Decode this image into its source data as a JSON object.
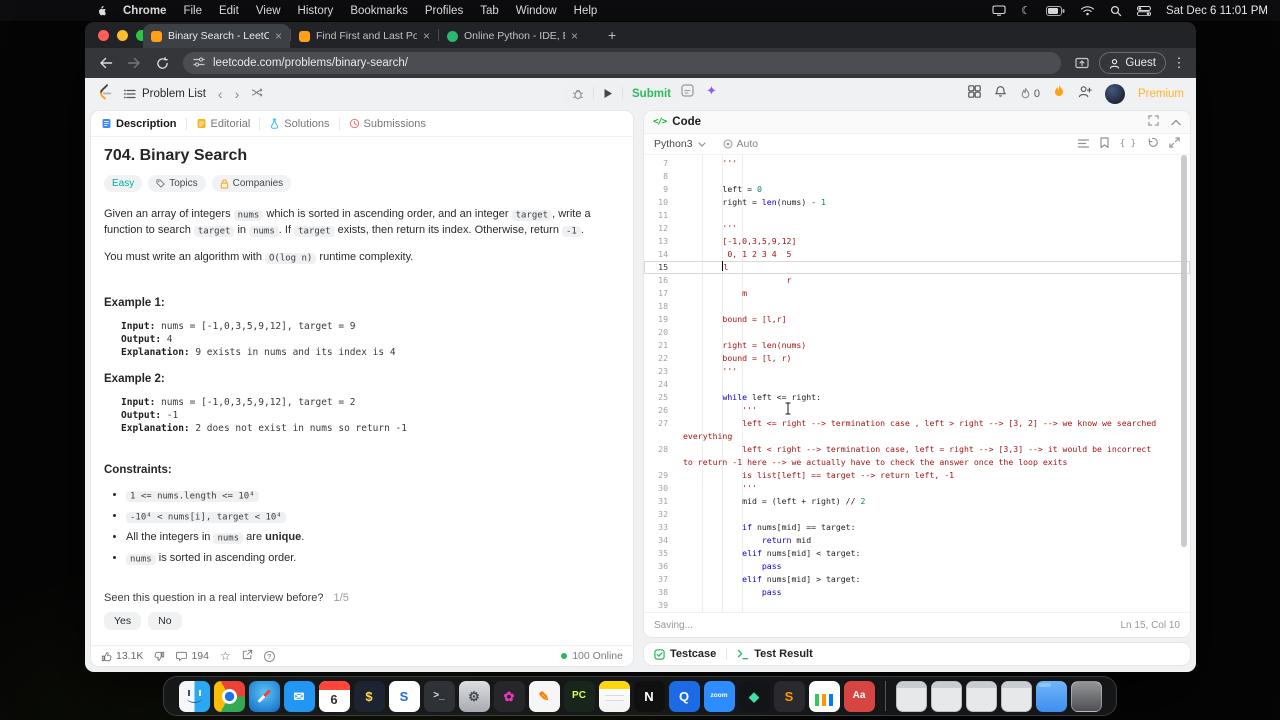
{
  "colors": {
    "submit_green": "#2cbb5d",
    "premium_orange": "#ffa116",
    "easy_teal": "#00af9b",
    "string_red": "#a31515",
    "keyword_blue": "#0b00c7",
    "number_green": "#098658"
  },
  "icons": {
    "close": "×",
    "new_tab": "+",
    "menu_dots": "⋮",
    "code_tag": "</>",
    "braces": "{ }",
    "sparkle": "✦",
    "moon": "☾",
    "star": "☆",
    "help": "?",
    "prev": "‹",
    "next": "›"
  },
  "menubar": {
    "menus": [
      "Chrome",
      "File",
      "Edit",
      "View",
      "History",
      "Bookmarks",
      "Profiles",
      "Tab",
      "Window",
      "Help"
    ],
    "clock": "Sat Dec 6 11:01 PM"
  },
  "browser": {
    "tabs": [
      {
        "title": "Binary Search - LeetCode",
        "favicon": "leetcode",
        "active": true
      },
      {
        "title": "Find First and Last Position o",
        "favicon": "leetcode",
        "active": false
      },
      {
        "title": "Online Python - IDE, Editor, C",
        "favicon": "python-ide",
        "active": false
      }
    ],
    "url": "leetcode.com/problems/binary-search/",
    "guest": "Guest"
  },
  "header": {
    "problem_list": "Problem List",
    "submit": "Submit",
    "streak": "0",
    "premium": "Premium"
  },
  "tabs_bar": {
    "description": "Description",
    "editorial": "Editorial",
    "solutions": "Solutions",
    "submissions": "Submissions"
  },
  "problem": {
    "title": "704. Binary Search",
    "difficulty": "Easy",
    "topics": "Topics",
    "companies": "Companies",
    "p1": [
      {
        "t": "Given an array of integers "
      },
      {
        "c": "nums"
      },
      {
        "t": " which is sorted in ascending order, and an integer "
      },
      {
        "c": "target"
      },
      {
        "t": ", write a function to search "
      },
      {
        "c": "target"
      },
      {
        "t": " in "
      },
      {
        "c": "nums"
      },
      {
        "t": ". If "
      },
      {
        "c": "target"
      },
      {
        "t": " exists, then return its index. Otherwise, return "
      },
      {
        "c": "-1"
      },
      {
        "t": "."
      }
    ],
    "p2": [
      {
        "t": "You must write an algorithm with "
      },
      {
        "c": "O(log n)"
      },
      {
        "t": " runtime complexity."
      }
    ],
    "example1_label": "Example 1:",
    "example1": [
      [
        "Input:",
        " nums = [-1,0,3,5,9,12], target = 9"
      ],
      [
        "Output:",
        " 4"
      ],
      [
        "Explanation:",
        " 9 exists in nums and its index is 4"
      ]
    ],
    "example2_label": "Example 2:",
    "example2": [
      [
        "Input:",
        " nums = [-1,0,3,5,9,12], target = 2"
      ],
      [
        "Output:",
        " -1"
      ],
      [
        "Explanation:",
        " 2 does not exist in nums so return -1"
      ]
    ],
    "constraints_label": "Constraints:",
    "constraints": [
      [
        {
          "c": "1 <= nums.length <= 10⁴"
        }
      ],
      [
        {
          "c": "-10⁴ < nums[i], target < 10⁴"
        }
      ],
      [
        {
          "t": "All the integers in "
        },
        {
          "c": "nums"
        },
        {
          "t": " are "
        },
        {
          "b": "unique"
        },
        {
          "t": "."
        }
      ],
      [
        {
          "c": "nums"
        },
        {
          "t": " is sorted in ascending order."
        }
      ]
    ],
    "survey_q": "Seen this question in a real interview before?",
    "survey_progress": "1/5",
    "yes": "Yes",
    "no": "No",
    "likes": "13.1K",
    "comments": "194",
    "online": "100 Online"
  },
  "code_panel": {
    "title": "Code",
    "lang": "Python3",
    "auto": "Auto",
    "saving": "Saving...",
    "cursor_pos": "Ln 15, Col 10",
    "testcase": "Testcase",
    "test_result": "Test Result"
  },
  "editor": {
    "rows": [
      {
        "n": "7",
        "s": [
          {
            "c": "str",
            "t": "        '''"
          }
        ]
      },
      {
        "n": "8",
        "s": []
      },
      {
        "n": "9",
        "s": [
          {
            "c": "pl",
            "t": "        left = "
          },
          {
            "c": "num",
            "t": "0"
          }
        ]
      },
      {
        "n": "10",
        "s": [
          {
            "c": "pl",
            "t": "        right = "
          },
          {
            "c": "kw",
            "t": "len"
          },
          {
            "c": "pl",
            "t": "(nums) - "
          },
          {
            "c": "num",
            "t": "1"
          }
        ]
      },
      {
        "n": "11",
        "s": []
      },
      {
        "n": "12",
        "s": [
          {
            "c": "str",
            "t": "        '''"
          }
        ]
      },
      {
        "n": "13",
        "s": [
          {
            "c": "str",
            "t": "        [-1,0,3,5,9,12]"
          }
        ]
      },
      {
        "n": "14",
        "s": [
          {
            "c": "str",
            "t": "         0, 1 2 3 4  5"
          }
        ]
      },
      {
        "n": "15",
        "cur": true,
        "s": [
          {
            "c": "str",
            "t": "        "
          },
          {
            "k": "caret"
          },
          {
            "c": "str",
            "t": "l"
          }
        ]
      },
      {
        "n": "16",
        "s": [
          {
            "c": "str",
            "t": "                     r"
          }
        ]
      },
      {
        "n": "17",
        "s": [
          {
            "c": "str",
            "t": "            m"
          }
        ]
      },
      {
        "n": "18",
        "s": []
      },
      {
        "n": "19",
        "s": [
          {
            "c": "str",
            "t": "        bound = [l,r]"
          }
        ]
      },
      {
        "n": "20",
        "s": []
      },
      {
        "n": "21",
        "s": [
          {
            "c": "str",
            "t": "        right = len(nums)"
          }
        ]
      },
      {
        "n": "22",
        "s": [
          {
            "c": "str",
            "t": "        bound = [l, r)"
          }
        ]
      },
      {
        "n": "23",
        "s": [
          {
            "c": "str",
            "t": "        '''"
          }
        ]
      },
      {
        "n": "24",
        "s": []
      },
      {
        "n": "25",
        "s": [
          {
            "c": "pl",
            "t": "        "
          },
          {
            "c": "kw",
            "t": "while"
          },
          {
            "c": "pl",
            "t": " left <= right:"
          }
        ]
      },
      {
        "n": "26",
        "s": [
          {
            "c": "str",
            "t": "            '''"
          }
        ]
      },
      {
        "n": "27",
        "s": [
          {
            "c": "str",
            "t": "            left <= right --> termination case , left > right --> [3, 2] --> we know we searched"
          }
        ]
      },
      {
        "n": "",
        "s": [
          {
            "c": "str",
            "t": "everything"
          }
        ]
      },
      {
        "n": "28",
        "s": [
          {
            "c": "str",
            "t": "            left < right --> termination case, left = right --> [3,3] --> it would be incorrect"
          }
        ]
      },
      {
        "n": "",
        "s": [
          {
            "c": "str",
            "t": "to return -1 here --> we actually have to check the answer once the loop exits"
          }
        ]
      },
      {
        "n": "29",
        "s": [
          {
            "c": "str",
            "t": "            is list[left] == target --> return left, -1"
          }
        ]
      },
      {
        "n": "30",
        "s": [
          {
            "c": "str",
            "t": "            '''"
          }
        ]
      },
      {
        "n": "31",
        "s": [
          {
            "c": "pl",
            "t": "            mid = (left + right) // "
          },
          {
            "c": "num",
            "t": "2"
          }
        ]
      },
      {
        "n": "32",
        "s": []
      },
      {
        "n": "33",
        "s": [
          {
            "c": "pl",
            "t": "            "
          },
          {
            "c": "kw",
            "t": "if"
          },
          {
            "c": "pl",
            "t": " nums[mid] == target:"
          }
        ]
      },
      {
        "n": "34",
        "s": [
          {
            "c": "pl",
            "t": "                "
          },
          {
            "c": "kw",
            "t": "return"
          },
          {
            "c": "pl",
            "t": " mid"
          }
        ]
      },
      {
        "n": "35",
        "s": [
          {
            "c": "pl",
            "t": "            "
          },
          {
            "c": "kw",
            "t": "elif"
          },
          {
            "c": "pl",
            "t": " nums[mid] < target:"
          }
        ]
      },
      {
        "n": "36",
        "s": [
          {
            "c": "pl",
            "t": "                "
          },
          {
            "c": "kw",
            "t": "pass"
          }
        ]
      },
      {
        "n": "37",
        "s": [
          {
            "c": "pl",
            "t": "            "
          },
          {
            "c": "kw",
            "t": "elif"
          },
          {
            "c": "pl",
            "t": " nums[mid] > target:"
          }
        ]
      },
      {
        "n": "38",
        "s": [
          {
            "c": "pl",
            "t": "                "
          },
          {
            "c": "kw",
            "t": "pass"
          }
        ]
      },
      {
        "n": "39",
        "s": []
      }
    ]
  },
  "dock": {
    "items": [
      {
        "name": "finder-dock-icon",
        "kind": "finder"
      },
      {
        "name": "chrome-dock-icon",
        "kind": "chrome"
      },
      {
        "name": "safari-dock-icon",
        "kind": "safari"
      },
      {
        "name": "mail-dock-icon",
        "bg": "#2196f3",
        "glyph": "✉",
        "fg": "#ffffff"
      },
      {
        "name": "calendar-dock-icon",
        "kind": "calendar",
        "glyph": "6",
        "fg": "#333333"
      },
      {
        "name": "finance-dock-icon",
        "bg": "#1b2430",
        "glyph": "$",
        "fg": "#ffd54a"
      },
      {
        "name": "stocks-dock-icon",
        "bg": "#ffffff",
        "glyph": "S",
        "fg": "#1d6ae5"
      },
      {
        "name": "terminal-dock-icon",
        "bg": "#2e3136",
        "glyph": ">_",
        "fg": "#e0e0e0"
      },
      {
        "name": "settings-dock-icon",
        "kind": "settings",
        "glyph": "⚙",
        "fg": "#474b51"
      },
      {
        "name": "photos-dock-icon",
        "bg": "#26262b",
        "glyph": "✿",
        "fg": "#e637b8"
      },
      {
        "name": "pencil-editor-dock-icon",
        "bg": "#f6f6f6",
        "glyph": "✎",
        "fg": "#ff7a00"
      },
      {
        "name": "pycharm-dock-icon",
        "bg": "#17251d",
        "glyph": "PC",
        "fg": "#d9ff4f"
      },
      {
        "name": "notes-dock-icon",
        "kind": "notes"
      },
      {
        "name": "notion-dock-icon",
        "bg": "#101010",
        "glyph": "N",
        "fg": "#ffffff"
      },
      {
        "name": "q-app-dock-icon",
        "bg": "#1d6ae5",
        "glyph": "Q",
        "fg": "#ffffff"
      },
      {
        "name": "zoom-dock-icon",
        "bg": "#2d8cff",
        "glyph": "zoom",
        "fg": "#ffffff"
      },
      {
        "name": "kiro-dock-icon",
        "bg": "#121418",
        "glyph": "◆",
        "fg": "#41e0a6"
      },
      {
        "name": "sublime-dock-icon",
        "bg": "#2a2a2e",
        "glyph": "S",
        "fg": "#ff9800"
      },
      {
        "name": "charts-dock-icon",
        "kind": "chart"
      },
      {
        "name": "textedit-dock-icon",
        "bg": "#d64541",
        "glyph": "Aa",
        "fg": "#ffffff"
      },
      {
        "kind": "divider"
      },
      {
        "name": "minimized-window-1",
        "kind": "window"
      },
      {
        "name": "minimized-window-2",
        "kind": "window"
      },
      {
        "name": "minimized-window-3",
        "kind": "window"
      },
      {
        "name": "minimized-window-4",
        "kind": "window"
      },
      {
        "name": "downloads-folder-icon",
        "kind": "folder"
      },
      {
        "name": "trash-icon",
        "kind": "trash"
      }
    ]
  }
}
